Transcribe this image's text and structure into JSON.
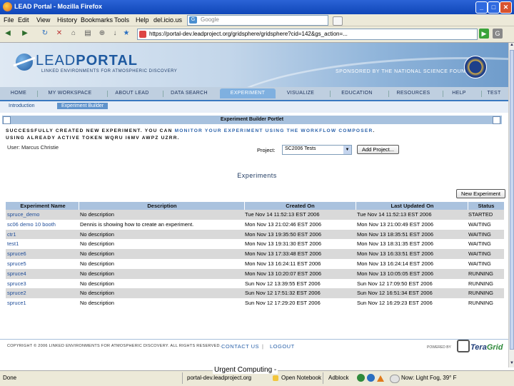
{
  "window": {
    "title": "LEAD Portal - Mozilla Firefox"
  },
  "menu": {
    "items": [
      "File",
      "Edit",
      "View",
      "History",
      "Bookmarks",
      "Tools",
      "Help",
      "del.icio.us"
    ],
    "search_placeholder": "Google"
  },
  "nav": {
    "url": "https://portal-dev.leadproject.org/gridsphere/gridsphere?cid=142&gs_action=..."
  },
  "banner": {
    "logo_text_light": "LEAD",
    "logo_text_bold": "PORTAL",
    "logo_sub": "LINKED ENVIRONMENTS FOR ATMOSPHERIC DISCOVERY",
    "sponsor": "SPONSORED BY THE NATIONAL SCIENCE FOUNDATION"
  },
  "tabs": [
    "HOME",
    "MY WORKSPACE",
    "ABOUT LEAD",
    "DATA SEARCH",
    "EXPERIMENT",
    "VISUALIZE",
    "EDUCATION",
    "RESOURCES",
    "HELP",
    "TEST"
  ],
  "active_tab": "EXPERIMENT",
  "subtabs": [
    "Introduction",
    "Experiment Builder"
  ],
  "portlet": {
    "title": "Experiment Builder Portlet",
    "msg_part1": "SUCCESSFULLY CREATED NEW EXPERIMENT. YOU CAN ",
    "msg_link": "MONITOR YOUR EXPERIMENT USING THE WORKFLOW COMPOSER",
    "msg_part2": ".",
    "msg_line2": "USING ALREADY ACTIVE TOKEN WQRU I6MV AWPZ UZRR.",
    "user": "User: Marcus Christie",
    "project_label": "Project:",
    "project_value": "SC2006 Tests",
    "add_project": "Add Project...",
    "experiments_heading": "Experiments",
    "new_experiment": "New Experiment"
  },
  "table": {
    "headers": [
      "Experiment Name",
      "Description",
      "Created On",
      "Last Updated On",
      "Status"
    ],
    "rows": [
      [
        "spruce_demo",
        "No description",
        "Tue Nov 14 11:52:13 EST 2006",
        "Tue Nov 14 11:52:13 EST 2006",
        "STARTED"
      ],
      [
        "sc06 demo 10 booth",
        "Dennis is showing how to create an experiment.",
        "Mon Nov 13 21:02:46 EST 2006",
        "Mon Nov 13 21:00:49 EST 2006",
        "WAITING"
      ],
      [
        "ctr1",
        "No description",
        "Mon Nov 13 19:35:50 EST 2006",
        "Mon Nov 13 18:35:51 EST 2006",
        "WAITING"
      ],
      [
        "test1",
        "No description",
        "Mon Nov 13 19:31:30 EST 2006",
        "Mon Nov 13 18:31:35 EST 2006",
        "WAITING"
      ],
      [
        "spruce6",
        "No description",
        "Mon Nov 13 17:33:48 EST 2006",
        "Mon Nov 13 16:33:51 EST 2006",
        "WAITING"
      ],
      [
        "spruce5",
        "No description",
        "Mon Nov 13 16:24:11 EST 2006",
        "Mon Nov 13 16:24:14 EST 2006",
        "WAITING"
      ],
      [
        "spruce4",
        "No description",
        "Mon Nov 13 10:20:07 EST 2006",
        "Mon Nov 13 10:05:05 EST 2006",
        "RUNNING"
      ],
      [
        "spruce3",
        "No description",
        "Sun Nov 12 13:39:55 EST 2006",
        "Sun Nov 12 17:09:50 EST 2006",
        "RUNNING"
      ],
      [
        "spruce2",
        "No description",
        "Sun Nov 12 17:51:32 EST 2006",
        "Sun Nov 12 16:51:34 EST 2006",
        "RUNNING"
      ],
      [
        "spruce1",
        "No description",
        "Sun Nov 12 17:29:20 EST 2006",
        "Sun Nov 12 16:29:23 EST 2006",
        "RUNNING"
      ]
    ]
  },
  "footer": {
    "copyright": "COPYRIGHT © 2006 LINKED ENVIRONMENTS FOR ATMOSPHERIC DISCOVERY. ALL RIGHTS RESERVED.",
    "contact": "CONTACT US",
    "separator": "|",
    "logout": "LOGOUT",
    "powered_by": "POWERED BY",
    "teragrid_a": "Tera",
    "teragrid_b": "Grid"
  },
  "status": {
    "done": "Done",
    "host": "portal-dev.leadproject.org",
    "notebook": "Open Notebook",
    "adblock": "Adblock",
    "weather": "Now: Light Fog, 39° F"
  },
  "caption": "Urgent Computing -",
  "colors": {
    "accent": "#3a78c0",
    "active_tab": "#7fb0e0",
    "link": "#2b62aa",
    "row_alt": "#d9d9d9"
  }
}
